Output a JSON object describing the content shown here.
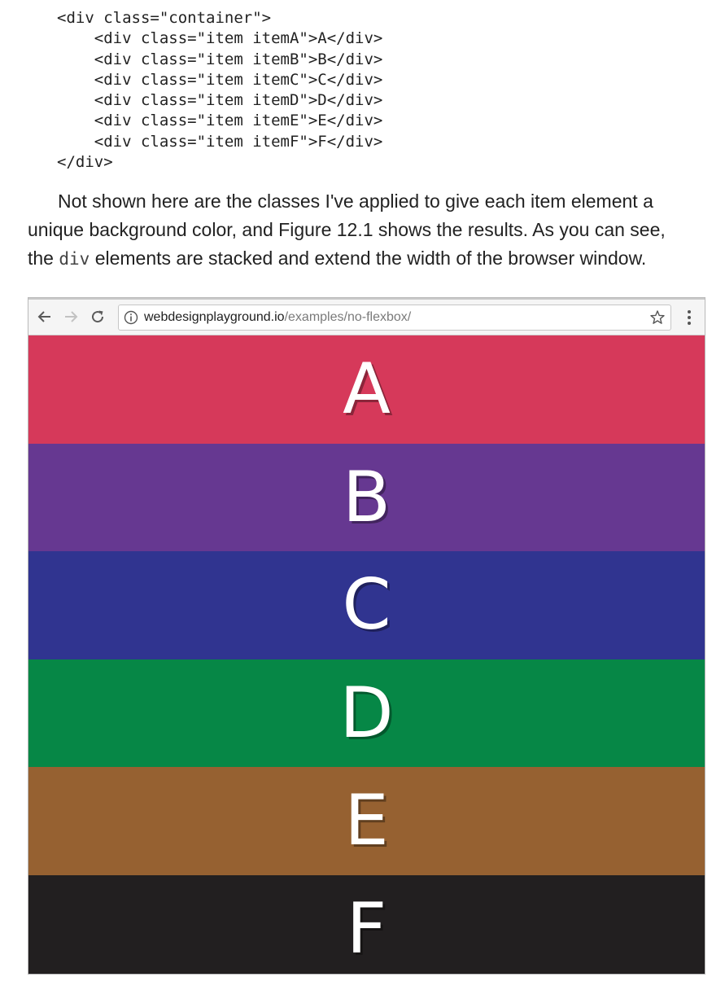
{
  "code_lines": [
    "<div class=\"container\">",
    "    <div class=\"item itemA\">A</div>",
    "    <div class=\"item itemB\">B</div>",
    "    <div class=\"item itemC\">C</div>",
    "    <div class=\"item itemD\">D</div>",
    "    <div class=\"item itemE\">E</div>",
    "    <div class=\"item itemF\">F</div>",
    "</div>"
  ],
  "paragraph": {
    "line1": "Not shown here are the classes I've applied to give each item element a",
    "line2": "unique background color, and Figure 12.1 shows the results. As you can see,",
    "line3_before": "the ",
    "line3_code": "div",
    "line3_after": " elements are stacked and extend the width of the browser window."
  },
  "browser": {
    "url_host": "webdesignplayground.io",
    "url_path": "/examples/no-flexbox/",
    "icons": [
      "back-arrow-icon",
      "forward-arrow-icon",
      "reload-icon",
      "info-icon",
      "star-icon",
      "more-vert-icon"
    ]
  },
  "items": [
    {
      "label": "A",
      "color": "#d6395a"
    },
    {
      "label": "B",
      "color": "#663891"
    },
    {
      "label": "C",
      "color": "#303490"
    },
    {
      "label": "D",
      "color": "#068746"
    },
    {
      "label": "E",
      "color": "#966131"
    },
    {
      "label": "F",
      "color": "#221f20"
    }
  ]
}
